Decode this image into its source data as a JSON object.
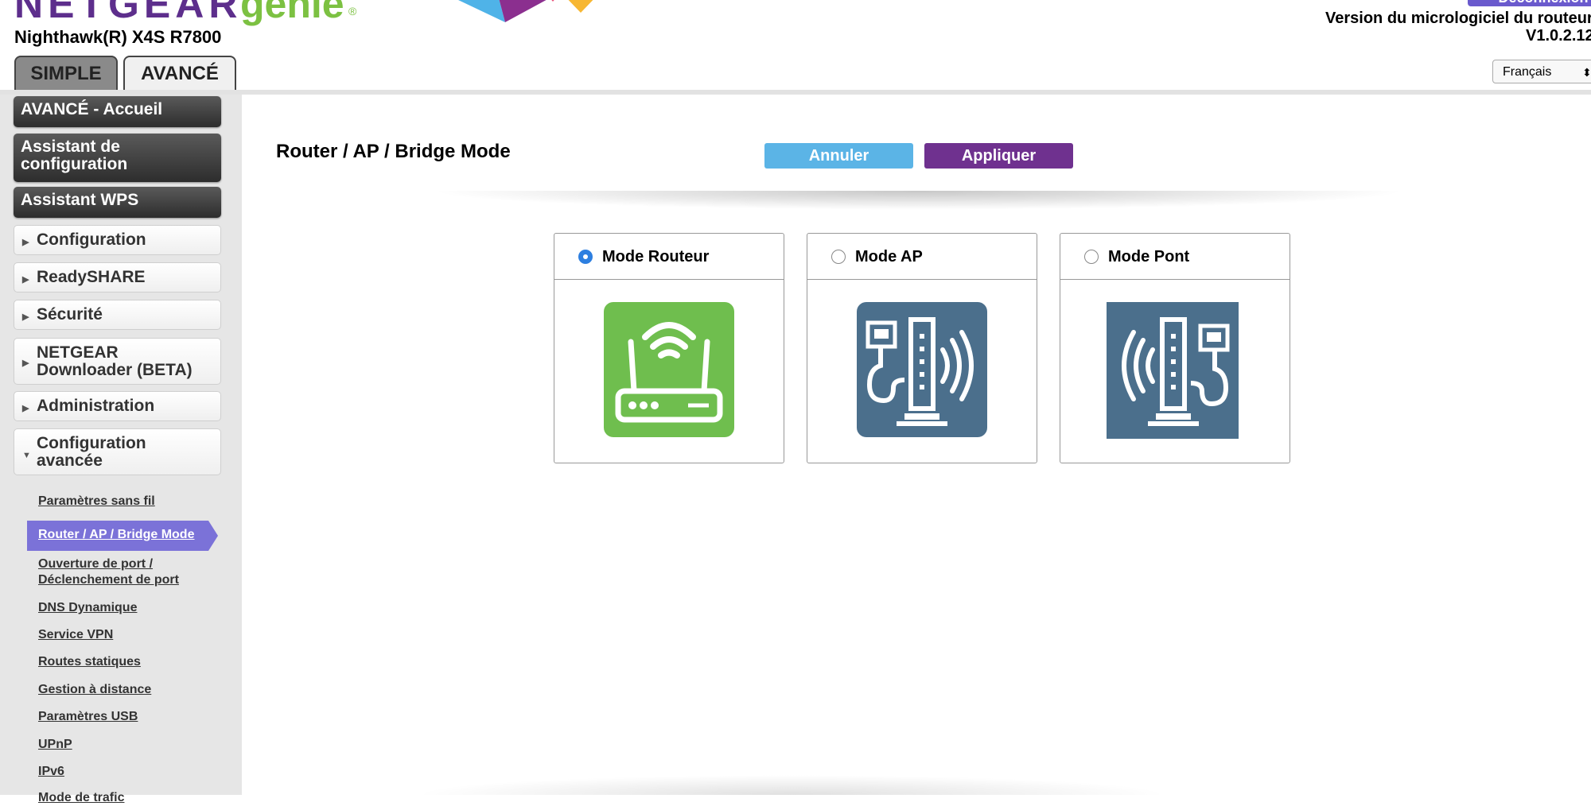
{
  "header": {
    "brand": "NETGEAR",
    "product": "genie",
    "model": "Nighthawk(R) X4S R7800",
    "logout_label": "Déconnexion",
    "firmware_label": "Version du micrologiciel du routeur",
    "firmware_version": "V1.0.2.12",
    "language": "Français",
    "brand_color": "#5d2e8c",
    "genie_color": "#7cc142"
  },
  "tabs": [
    {
      "label": "SIMPLE"
    },
    {
      "label": "AVANCÉ"
    }
  ],
  "sidebar": {
    "main_buttons": [
      {
        "label": "AVANCÉ - Accueil"
      },
      {
        "label": "Assistant de configuration"
      },
      {
        "label": "Assistant WPS"
      }
    ],
    "sections": [
      {
        "label": "Configuration"
      },
      {
        "label": "ReadySHARE"
      },
      {
        "label": "Sécurité"
      },
      {
        "label": "NETGEAR Downloader (BETA)"
      },
      {
        "label": "Administration"
      },
      {
        "label": "Configuration avancée"
      }
    ],
    "sub_items": [
      {
        "label": "Paramètres sans fil"
      },
      {
        "label": "Router / AP / Bridge Mode"
      },
      {
        "label": "Ouverture de port / Déclenchement de port"
      },
      {
        "label": "DNS Dynamique"
      },
      {
        "label": "Service VPN"
      },
      {
        "label": "Routes statiques"
      },
      {
        "label": "Gestion à distance"
      },
      {
        "label": "Paramètres USB"
      },
      {
        "label": "UPnP"
      },
      {
        "label": "IPv6"
      },
      {
        "label": "Mode de trafic"
      }
    ],
    "active_sub": "Router / AP / Bridge Mode",
    "active_color": "#7b72d8"
  },
  "main": {
    "title": "Router / AP / Bridge Mode",
    "cancel_label": "Annuler",
    "apply_label": "Appliquer",
    "cancel_color": "#5bb4e6",
    "apply_color": "#6f318f",
    "modes": [
      {
        "label": "Mode Routeur",
        "selected": true,
        "icon": "router-icon"
      },
      {
        "label": "Mode AP",
        "selected": false,
        "icon": "access-point-icon"
      },
      {
        "label": "Mode Pont",
        "selected": false,
        "icon": "bridge-icon"
      }
    ]
  }
}
